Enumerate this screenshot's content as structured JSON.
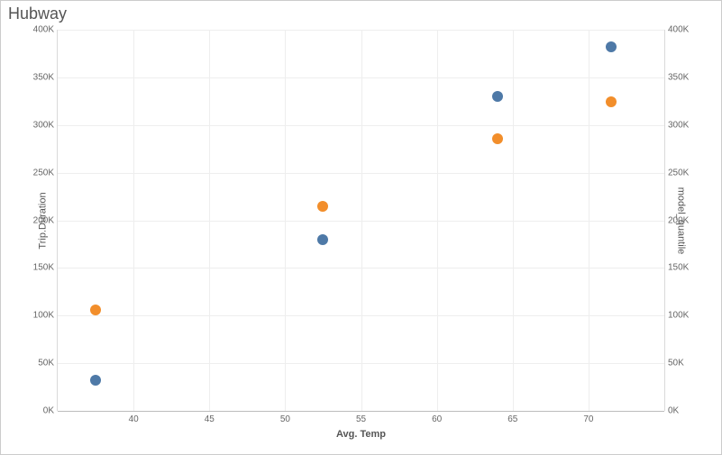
{
  "chart_data": {
    "type": "scatter",
    "title": "Hubway",
    "x": {
      "label": "Avg. Temp",
      "range": [
        35,
        75
      ],
      "ticks": [
        40,
        45,
        50,
        55,
        60,
        65,
        70
      ]
    },
    "y_left": {
      "label": "Trip.Duration",
      "range": [
        0,
        400000
      ],
      "ticks": [
        0,
        50000,
        100000,
        150000,
        200000,
        250000,
        300000,
        350000,
        400000
      ],
      "tick_labels": [
        "0K",
        "50K",
        "100K",
        "150K",
        "200K",
        "250K",
        "300K",
        "350K",
        "400K"
      ]
    },
    "y_right": {
      "label": "model_quantile",
      "range": [
        0,
        400000
      ],
      "ticks": [
        0,
        50000,
        100000,
        150000,
        200000,
        250000,
        300000,
        350000,
        400000
      ],
      "tick_labels": [
        "0K",
        "50K",
        "100K",
        "150K",
        "200K",
        "250K",
        "300K",
        "350K",
        "400K"
      ]
    },
    "series": [
      {
        "name": "Trip.Duration",
        "color": "#4e79a7",
        "axis": "left",
        "points": [
          {
            "x": 37.5,
            "y": 32000
          },
          {
            "x": 52.5,
            "y": 180000
          },
          {
            "x": 64.0,
            "y": 330000
          },
          {
            "x": 71.5,
            "y": 382000
          }
        ]
      },
      {
        "name": "model_quantile",
        "color": "#f28e2b",
        "axis": "right",
        "points": [
          {
            "x": 37.5,
            "y": 106000
          },
          {
            "x": 52.5,
            "y": 215000
          },
          {
            "x": 64.0,
            "y": 286000
          },
          {
            "x": 71.5,
            "y": 324000
          }
        ]
      }
    ]
  }
}
